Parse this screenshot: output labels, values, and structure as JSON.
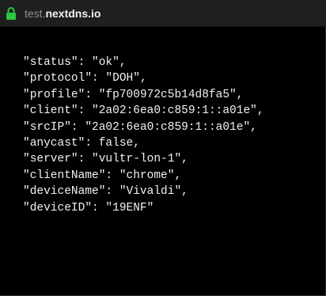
{
  "address_bar": {
    "url_prefix": "test.",
    "url_domain": "nextdns.io",
    "lock_icon": "lock-icon",
    "accent_color": "#27c93f"
  },
  "json_lines": [
    {
      "key": "\"status\"",
      "value": "\"ok\"",
      "trail": ","
    },
    {
      "key": "\"protocol\"",
      "value": "\"DOH\"",
      "trail": ","
    },
    {
      "key": "\"profile\"",
      "value": "\"fp700972c5b14d8fa5\"",
      "trail": ","
    },
    {
      "key": "\"client\"",
      "value": "\"2a02:6ea0:c859:1::a01e\"",
      "trail": ","
    },
    {
      "key": "\"srcIP\"",
      "value": "\"2a02:6ea0:c859:1::a01e\"",
      "trail": ","
    },
    {
      "key": "\"anycast\"",
      "value": "false",
      "trail": ","
    },
    {
      "key": "\"server\"",
      "value": "\"vultr-lon-1\"",
      "trail": ","
    },
    {
      "key": "\"clientName\"",
      "value": "\"chrome\"",
      "trail": ","
    },
    {
      "key": "\"deviceName\"",
      "value": "\"Vivaldi\"",
      "trail": ","
    },
    {
      "key": "\"deviceID\"",
      "value": "\"19ENF\"",
      "trail": ""
    }
  ]
}
